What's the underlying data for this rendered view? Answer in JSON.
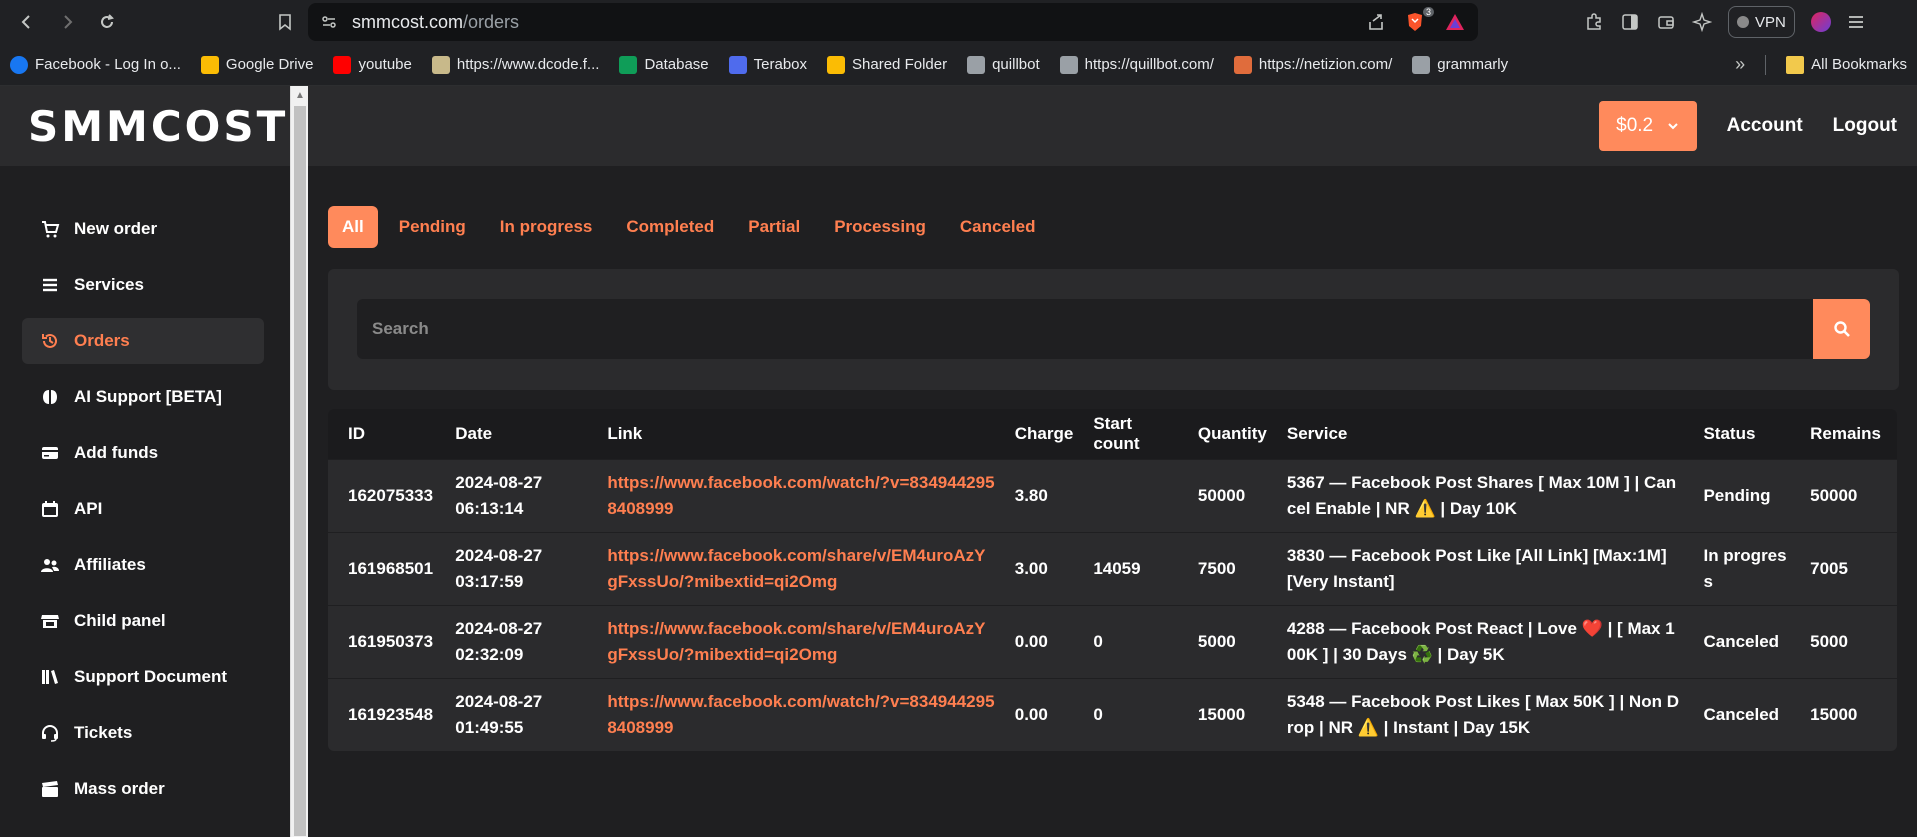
{
  "browser": {
    "url_host": "smmcost.com",
    "url_path": "/orders",
    "shield_badge": "3",
    "vpn_label": "VPN"
  },
  "bookmarks": [
    {
      "label": "Facebook - Log In o...",
      "icon": "facebook-icon",
      "color": "#1877f2"
    },
    {
      "label": "Google Drive",
      "icon": "google-drive-icon",
      "color": "#fbbc04"
    },
    {
      "label": "youtube",
      "icon": "youtube-icon",
      "color": "#ff0000"
    },
    {
      "label": "https://www.dcode.f...",
      "icon": "dcode-icon",
      "color": "#c8b98a"
    },
    {
      "label": "Database",
      "icon": "sheets-icon",
      "color": "#0f9d58"
    },
    {
      "label": "Terabox",
      "icon": "terabox-icon",
      "color": "#4f6bed"
    },
    {
      "label": "Shared Folder",
      "icon": "google-drive-icon",
      "color": "#fbbc04"
    },
    {
      "label": "quillbot",
      "icon": "quillbot-icon",
      "color": "#9aa0a6"
    },
    {
      "label": "https://quillbot.com/",
      "icon": "feather-icon",
      "color": "#9aa0a6"
    },
    {
      "label": "https://netizion.com/",
      "icon": "netizion-icon",
      "color": "#e06c3c"
    },
    {
      "label": "grammarly",
      "icon": "quillbot-icon",
      "color": "#9aa0a6"
    }
  ],
  "all_bookmarks_label": "All Bookmarks",
  "app": {
    "logo": "SMMCOST",
    "balance": "$0.2",
    "account_label": "Account",
    "logout_label": "Logout"
  },
  "sidebar": {
    "items": [
      {
        "label": "New order",
        "icon": "cart-icon"
      },
      {
        "label": "Services",
        "icon": "list-icon"
      },
      {
        "label": "Orders",
        "icon": "history-icon",
        "active": true
      },
      {
        "label": "AI Support [BETA]",
        "icon": "brain-icon"
      },
      {
        "label": "Add funds",
        "icon": "credit-card-icon"
      },
      {
        "label": "API",
        "icon": "calendar-icon"
      },
      {
        "label": "Affiliates",
        "icon": "users-icon"
      },
      {
        "label": "Child panel",
        "icon": "store-icon"
      },
      {
        "label": "Support Document",
        "icon": "books-icon"
      },
      {
        "label": "Tickets",
        "icon": "headset-icon"
      },
      {
        "label": "Mass order",
        "icon": "clapperboard-icon"
      }
    ]
  },
  "filters": [
    "All",
    "Pending",
    "In progress",
    "Completed",
    "Partial",
    "Processing",
    "Canceled"
  ],
  "search": {
    "placeholder": "Search"
  },
  "table": {
    "headers": [
      "ID",
      "Date",
      "Link",
      "Charge",
      "Start count",
      "Quantity",
      "Service",
      "Status",
      "Remains"
    ],
    "rows": [
      {
        "id": "162075333",
        "date": "2024-08-27",
        "time": "06:13:14",
        "link": "https://www.facebook.com/watch/?v=8349442958408999",
        "charge": "3.80",
        "start_count": "",
        "quantity": "50000",
        "service": "5367 — Facebook Post Shares [ Max 10M ] | Cancel Enable | NR ⚠️ | Day 10K",
        "status": "Pending",
        "remains": "50000"
      },
      {
        "id": "161968501",
        "date": "2024-08-27",
        "time": "03:17:59",
        "link": "https://www.facebook.com/share/v/EM4uroAzYgFxssUo/?mibextid=qi2Omg",
        "charge": "3.00",
        "start_count": "14059",
        "quantity": "7500",
        "service": "3830 — Facebook Post Like [All Link] [Max:1M] [Very Instant]",
        "status": "In progress",
        "remains": "7005"
      },
      {
        "id": "161950373",
        "date": "2024-08-27",
        "time": "02:32:09",
        "link": "https://www.facebook.com/share/v/EM4uroAzYgFxssUo/?mibextid=qi2Omg",
        "charge": "0.00",
        "start_count": "0",
        "quantity": "5000",
        "service": "4288 — Facebook Post React | Love ❤️ | [ Max 100K ] | 30 Days ♻️ | Day 5K",
        "status": "Canceled",
        "remains": "5000"
      },
      {
        "id": "161923548",
        "date": "2024-08-27",
        "time": "01:49:55",
        "link": "https://www.facebook.com/watch/?v=8349442958408999",
        "charge": "0.00",
        "start_count": "0",
        "quantity": "15000",
        "service": "5348 — Facebook Post Likes [ Max 50K ] | Non Drop | NR ⚠️ | Instant | Day 15K",
        "status": "Canceled",
        "remains": "15000"
      }
    ]
  },
  "colors": {
    "accent": "#ff7f50",
    "accent_button": "#ff8a5c",
    "panel": "#2b2b2d",
    "background": "#1f1f21"
  }
}
